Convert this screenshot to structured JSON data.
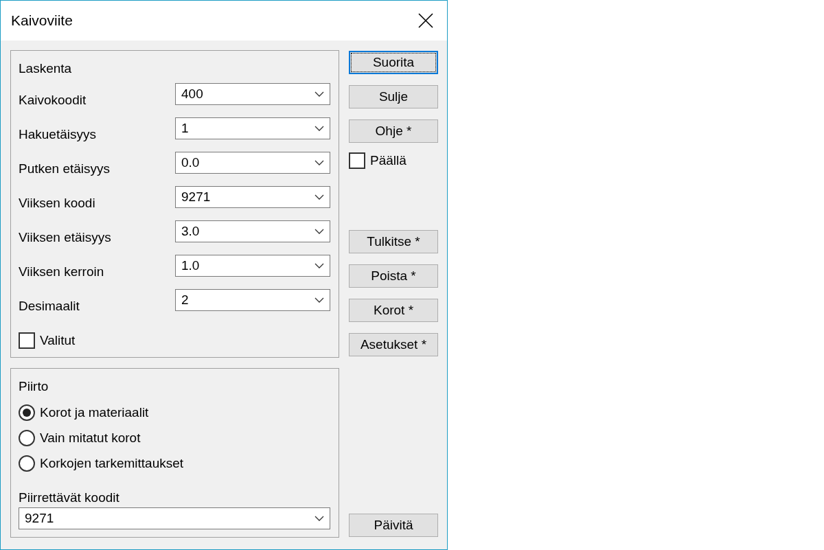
{
  "window": {
    "title": "Kaivoviite"
  },
  "calculation": {
    "title": "Laskenta",
    "fields": [
      {
        "label": "Kaivokoodit",
        "value": "400"
      },
      {
        "label": "Hakuetäisyys",
        "value": "1"
      },
      {
        "label": "Putken etäisyys",
        "value": "0.0"
      },
      {
        "label": "Viiksen koodi",
        "value": "9271"
      },
      {
        "label": "Viiksen etäisyys",
        "value": "3.0"
      },
      {
        "label": "Viiksen kerroin",
        "value": "1.0"
      },
      {
        "label": "Desimaalit",
        "value": "2"
      }
    ],
    "selected_only": {
      "label": "Valitut",
      "checked": false
    }
  },
  "drawing": {
    "title": "Piirto",
    "options": [
      {
        "label": "Korot ja materiaalit",
        "selected": true
      },
      {
        "label": "Vain mitatut korot",
        "selected": false
      },
      {
        "label": "Korkojen tarkemittaukset",
        "selected": false
      }
    ],
    "codes": {
      "label": "Piirrettävät koodit",
      "value": "9271"
    }
  },
  "top_buttons": [
    {
      "label": "Suorita",
      "focused": true
    },
    {
      "label": "Sulje",
      "focused": false
    },
    {
      "label": "Ohje *",
      "focused": false
    }
  ],
  "on_checkbox": {
    "label": "Päällä",
    "checked": false
  },
  "lower_buttons": [
    {
      "label": "Tulkitse *",
      "focused": false
    },
    {
      "label": "Poista *",
      "focused": false
    },
    {
      "label": "Korot *",
      "focused": false
    },
    {
      "label": "Asetukset *",
      "focused": false
    }
  ],
  "refresh_button": {
    "label": "Päivitä",
    "focused": false
  }
}
